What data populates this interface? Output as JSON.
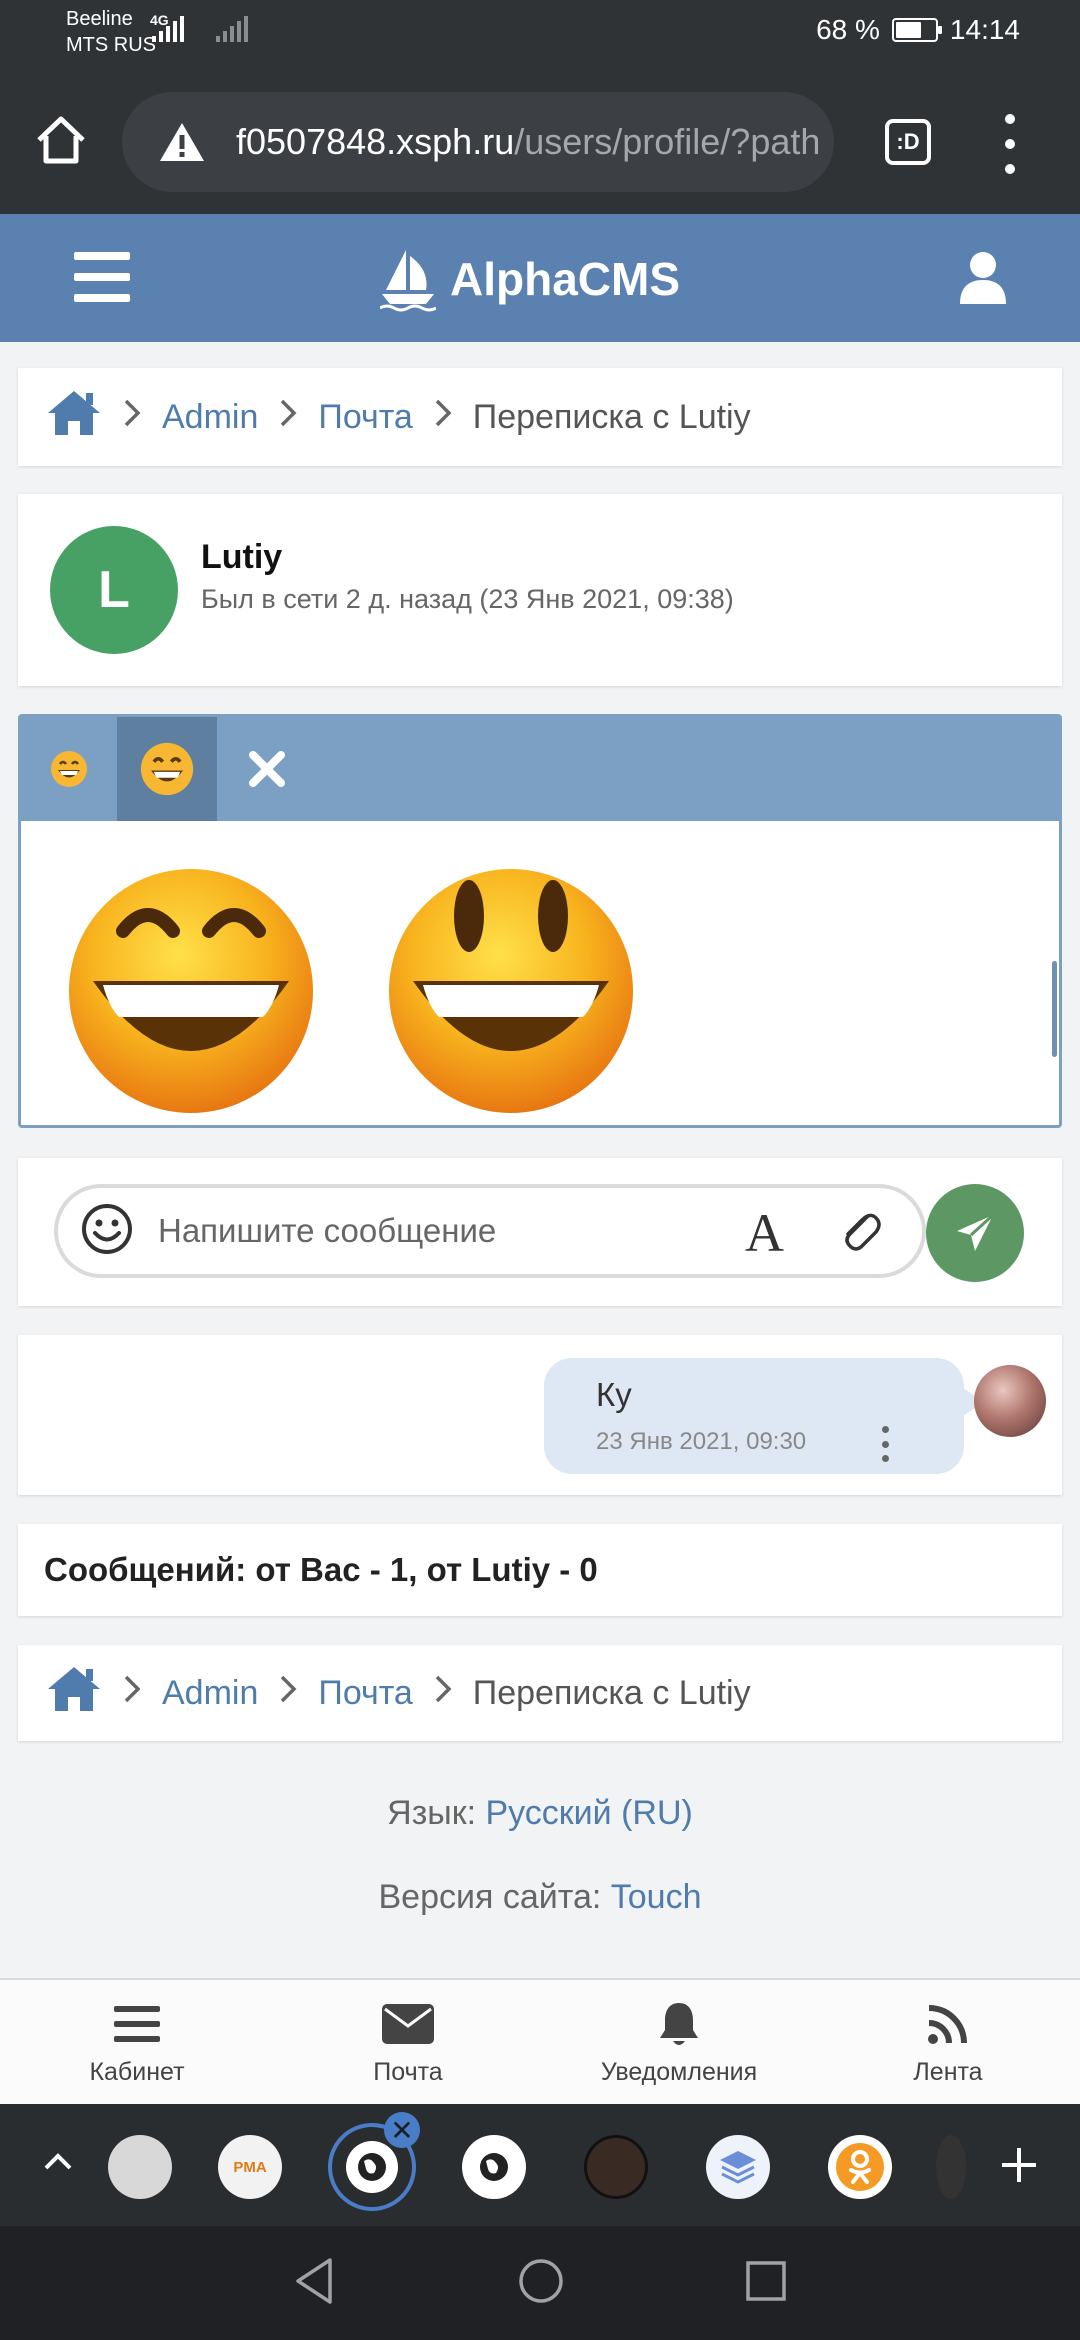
{
  "status_bar": {
    "carrier_1": "Beeline",
    "carrier_2": "MTS RUS",
    "network_type": "4G",
    "battery": "68 %",
    "time": "14:14"
  },
  "browser": {
    "url_domain": "f0507848.xsph.ru",
    "url_path": "/users/profile/?path",
    "tabs_label": ":D",
    "icons": [
      "home-icon",
      "warning-icon",
      "tabs-icon",
      "more-vert-icon"
    ]
  },
  "site": {
    "brand": "AlphaCMS",
    "icons": [
      "hamburger-icon",
      "sailboat-logo",
      "user-icon"
    ]
  },
  "breadcrumb": {
    "items": [
      "Admin",
      "Почта"
    ],
    "current": "Переписка с Lutiy"
  },
  "contact": {
    "initial": "L",
    "name": "Lutiy",
    "status": "Был в сети 2 д. назад (23 Янв 2021, 09:38)"
  },
  "emoji_panel": {
    "tab_icons": [
      "grinning-emoji-icon",
      "grinning-emoji-icon",
      "close-icon"
    ],
    "active_tab": 1,
    "items": [
      "grinning-smiling-eyes-emoji",
      "smiley-emoji"
    ]
  },
  "composer": {
    "placeholder": "Напишите сообщение",
    "value": ""
  },
  "messages": [
    {
      "text": "Ку",
      "time": "23 Янв 2021, 09:30"
    }
  ],
  "stats": {
    "text": "Сообщений: от Вас - 1, от Lutiy - 0"
  },
  "footer": {
    "language_label": "Язык:",
    "language_value": "Русский (RU)",
    "version_label": "Версия сайта:",
    "version_value": "Touch"
  },
  "site_nav": [
    {
      "label": "Кабинет",
      "icon": "list-icon"
    },
    {
      "label": "Почта",
      "icon": "envelope-icon"
    },
    {
      "label": "Уведомления",
      "icon": "bell-icon"
    },
    {
      "label": "Лента",
      "icon": "rss-icon"
    }
  ],
  "colors": {
    "header": "#5b81b0",
    "link": "#4f7cac",
    "avatar": "#47a064",
    "send": "#5c9764",
    "bubble": "#dde8f4"
  }
}
